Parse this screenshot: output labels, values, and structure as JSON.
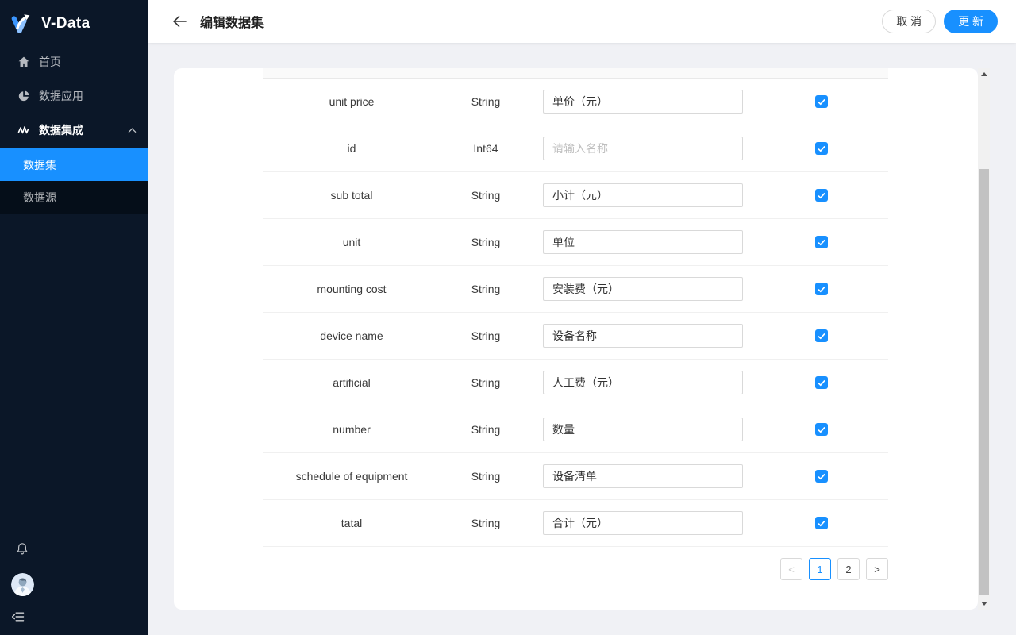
{
  "colors": {
    "accent": "#1890ff",
    "sidebar_bg": "#0b1728",
    "submenu_bg": "#050e19",
    "page_bg": "#f0f1f5"
  },
  "sidebar": {
    "logo_text": "V-Data",
    "menu": [
      {
        "label": "首页",
        "icon": "home-icon"
      },
      {
        "label": "数据应用",
        "icon": "pie-chart-icon"
      },
      {
        "label": "数据集成",
        "icon": "pulse-icon",
        "expanded": true
      }
    ],
    "submenu": [
      {
        "label": "数据集",
        "active": true
      },
      {
        "label": "数据源",
        "active": false
      }
    ],
    "bell_icon": "bell-icon",
    "fold_icon": "menu-fold-icon"
  },
  "header": {
    "title": "编辑数据集",
    "cancel_label": "取 消",
    "update_label": "更 新"
  },
  "table": {
    "rows": [
      {
        "name": "unit price",
        "type": "String",
        "value": "单价（元）",
        "checked": true
      },
      {
        "name": "id",
        "type": "Int64",
        "value": "",
        "placeholder": "请输入名称",
        "checked": true
      },
      {
        "name": "sub total",
        "type": "String",
        "value": "小计（元）",
        "checked": true
      },
      {
        "name": "unit",
        "type": "String",
        "value": "单位",
        "checked": true
      },
      {
        "name": "mounting cost",
        "type": "String",
        "value": "安装费（元）",
        "checked": true
      },
      {
        "name": "device name",
        "type": "String",
        "value": "设备名称",
        "checked": true
      },
      {
        "name": "artificial",
        "type": "String",
        "value": "人工费（元）",
        "checked": true
      },
      {
        "name": "number",
        "type": "String",
        "value": "数量",
        "checked": true
      },
      {
        "name": "schedule of equipment",
        "type": "String",
        "value": "设备清单",
        "checked": true
      },
      {
        "name": "tatal",
        "type": "String",
        "value": "合计（元）",
        "checked": true
      }
    ]
  },
  "pagination": {
    "prev": "<",
    "pages": [
      "1",
      "2"
    ],
    "active_page": "1",
    "next": ">"
  }
}
